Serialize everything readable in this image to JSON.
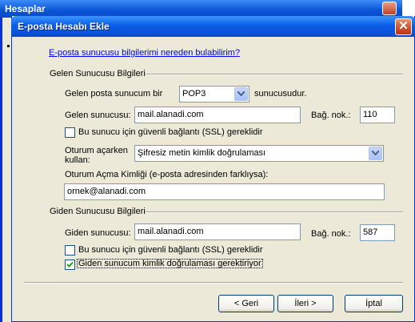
{
  "background_window": {
    "title": "Hesaplar"
  },
  "dialog": {
    "title": "E-posta Hesabı Ekle",
    "help_link": "E-posta sunucusu bilgilerimi nereden bulabilirim?",
    "incoming": {
      "section_title": "Gelen Sunucusu Bilgileri",
      "type_prefix": "Gelen posta sunucum bir",
      "type_value": "POP3",
      "type_suffix": "sunucusudur.",
      "server_label": "Gelen sunucusu:",
      "server_value": "mail.alanadi.com",
      "port_label": "Bağ. nok.:",
      "port_value": "110",
      "ssl_label": "Bu sunucu için güvenli bağlantı (SSL) gereklidir",
      "ssl_checked": false,
      "login_label_line1": "Oturum açarken",
      "login_label_line2": "kullan:",
      "login_value": "Şifresiz metin kimlik doğrulaması",
      "loginid_label": "Oturum Açma Kimliği (e-posta adresinden farklıysa):",
      "loginid_value": "ornek@alanadi.com"
    },
    "outgoing": {
      "section_title": "Giden Sunucusu Bilgileri",
      "server_label": "Giden sunucusu:",
      "server_value": "mail.alanadi.com",
      "port_label": "Bağ. nok.:",
      "port_value": "587",
      "ssl_label": "Bu sunucu için güvenli bağlantı (SSL) gereklidir",
      "ssl_checked": false,
      "auth_label": "Giden sunucum kimlik doğrulaması gerektiriyor",
      "auth_checked": true
    },
    "buttons": {
      "back": "< Geri",
      "next": "İleri >",
      "cancel": "İptal"
    }
  },
  "colors": {
    "titlebar": "#0a5ee5",
    "dialog_face": "#ece9d8",
    "link": "#0000ff",
    "input_border": "#7f9db9",
    "checkmark": "#21a121"
  }
}
